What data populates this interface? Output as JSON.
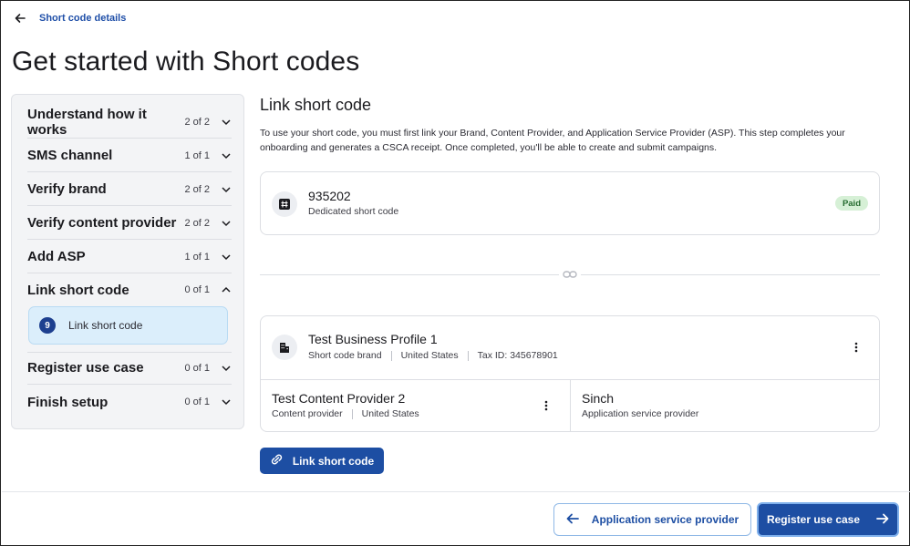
{
  "breadcrumb": {
    "back_icon": "arrow-left-icon",
    "label": "Short code details"
  },
  "page_title": "Get started with Short codes",
  "sidebar": {
    "steps": [
      {
        "name": "Understand how it works",
        "count": "2 of 2",
        "expanded": false
      },
      {
        "name": "SMS channel",
        "count": "1 of 1",
        "expanded": false
      },
      {
        "name": "Verify brand",
        "count": "2 of 2",
        "expanded": false
      },
      {
        "name": "Verify content provider",
        "count": "2 of 2",
        "expanded": false
      },
      {
        "name": "Add ASP",
        "count": "1 of 1",
        "expanded": false
      },
      {
        "name": "Link short code",
        "count": "0 of 1",
        "expanded": true
      },
      {
        "name": "Register use case",
        "count": "0 of 1",
        "expanded": false
      },
      {
        "name": "Finish setup",
        "count": "0 of 1",
        "expanded": false
      }
    ],
    "active_substep": {
      "number": "9",
      "label": "Link short code"
    }
  },
  "main": {
    "title": "Link short code",
    "intro": "To use your short code, you must first link your Brand, Content Provider, and Application Service Provider (ASP). This step completes your onboarding and generates a CSCA receipt. Once completed, you'll be able to create and submit campaigns.",
    "short_code_card": {
      "icon": "hash-icon",
      "code": "935202",
      "type": "Dedicated short code",
      "badge": "Paid",
      "badge_color": "#d6f0d6"
    },
    "profile_card": {
      "icon": "building-icon",
      "name": "Test Business Profile 1",
      "role": "Short code brand",
      "country": "United States",
      "tax_id": "Tax ID: 345678901",
      "content_provider": {
        "name": "Test Content Provider 2",
        "role": "Content provider",
        "country": "United States"
      },
      "asp": {
        "name": "Sinch",
        "role": "Application service provider"
      }
    },
    "link_button": "Link short code"
  },
  "footer": {
    "back_button": "Application service provider",
    "next_button": "Register use case"
  },
  "colors": {
    "accent": "#1d4ea3",
    "link": "#1f4fa8",
    "substep_bg": "#dbeefb"
  }
}
